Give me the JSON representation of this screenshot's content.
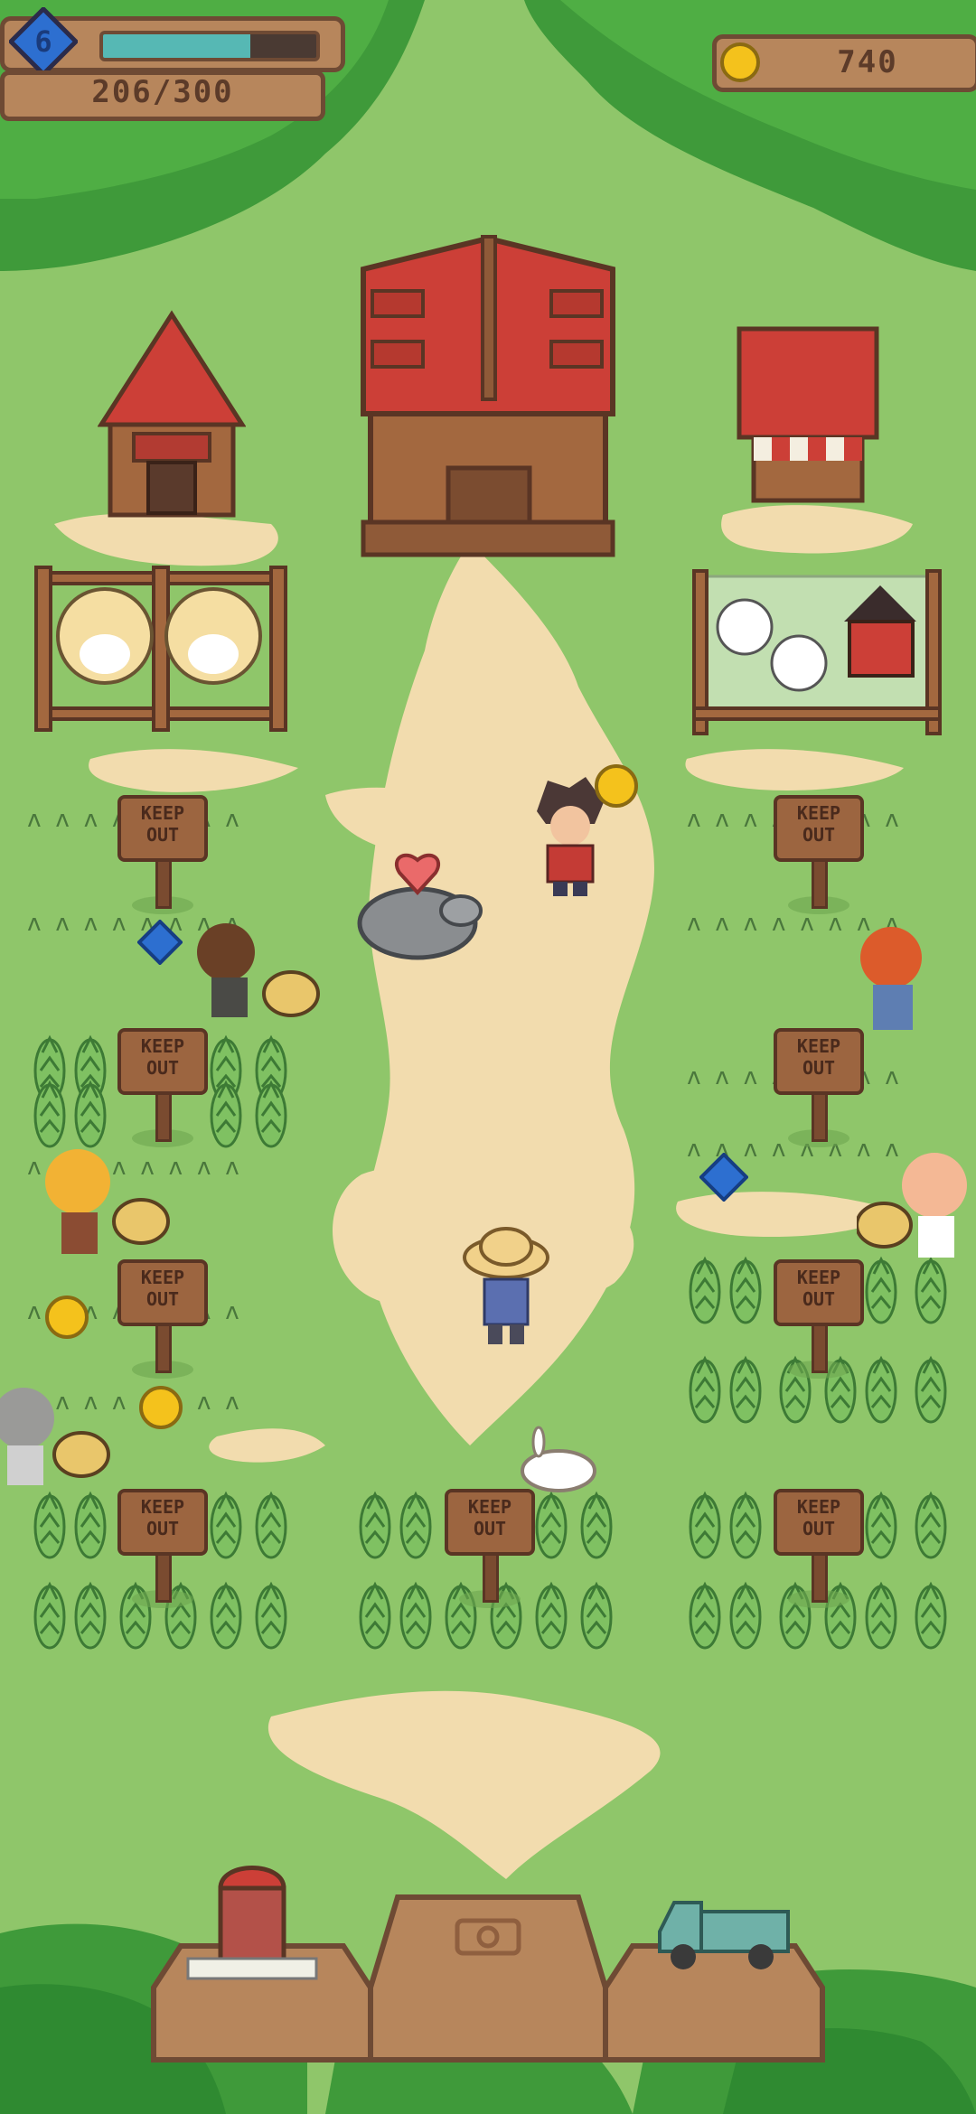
{
  "hud": {
    "level": "6",
    "xp_text": "206/300",
    "xp_progress": 0.69,
    "coins": "740"
  },
  "signs": [
    {
      "line1": "KEEP",
      "line2": "OUT"
    },
    {
      "line1": "KEEP",
      "line2": "OUT"
    },
    {
      "line1": "KEEP",
      "line2": "OUT"
    },
    {
      "line1": "KEEP",
      "line2": "OUT"
    },
    {
      "line1": "KEEP",
      "line2": "OUT"
    },
    {
      "line1": "KEEP",
      "line2": "OUT"
    },
    {
      "line1": "KEEP",
      "line2": "OUT"
    },
    {
      "line1": "KEEP",
      "line2": "OUT"
    },
    {
      "line1": "KEEP",
      "line2": "OUT"
    }
  ],
  "dock": {
    "left": "silo-icon",
    "center": "camera-icon",
    "right": "truck-icon"
  },
  "colors": {
    "grass": "#8fc66a",
    "path": "#f2dcae",
    "roof": "#cc3f37",
    "wood": "#9c6540",
    "tree": "#3f9a3a",
    "xp_bar": "#56b8b4",
    "gem": "#2d6fd0",
    "coin": "#f4c21c"
  }
}
